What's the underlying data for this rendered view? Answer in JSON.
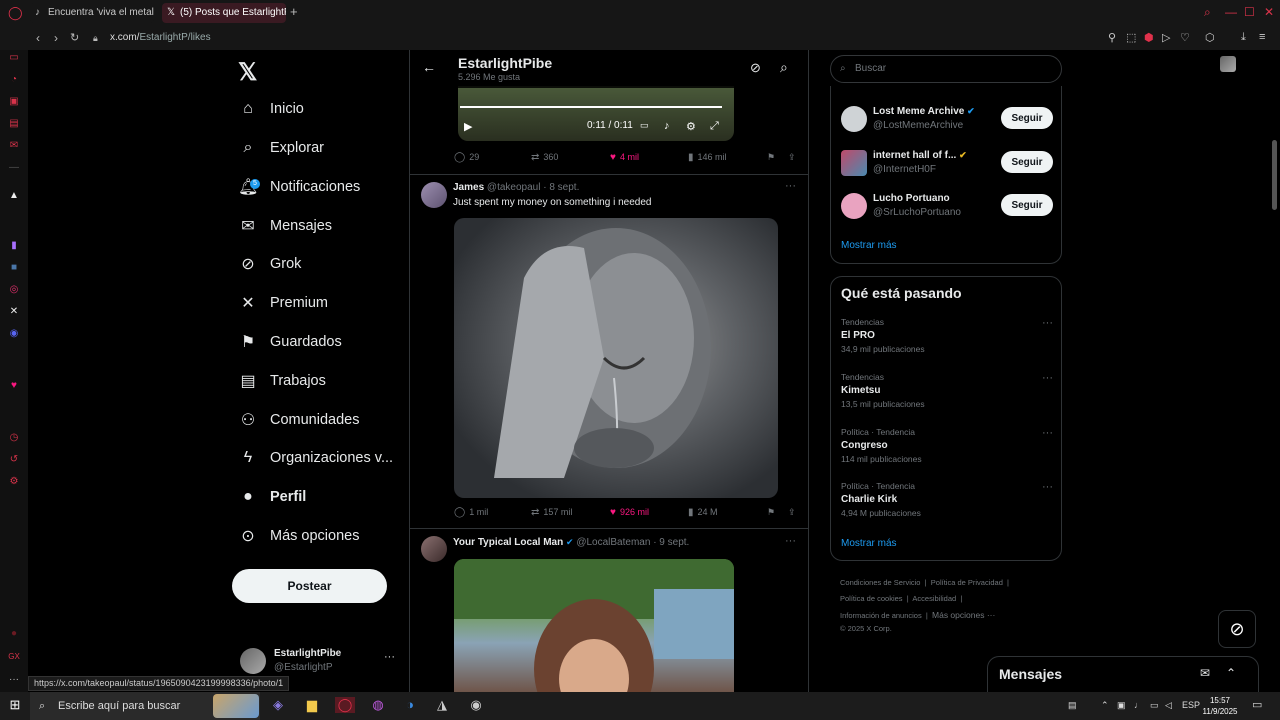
{
  "browser": {
    "tabs": [
      {
        "label": "Encuentra 'viva el metal e",
        "icon": "tiktok-icon"
      },
      {
        "label": "(5) Posts que EstarlightP",
        "icon": "x-icon"
      }
    ],
    "url_host": "x.com/",
    "url_path": "EstarlightP/likes",
    "status_url": "https://x.com/takeopaul/status/1965090423199998336/photo/1"
  },
  "nav": {
    "items": [
      {
        "label": "Inicio",
        "icon": "home-icon"
      },
      {
        "label": "Explorar",
        "icon": "search-icon"
      },
      {
        "label": "Notificaciones",
        "icon": "bell-icon",
        "badge": "5"
      },
      {
        "label": "Mensajes",
        "icon": "mail-icon"
      },
      {
        "label": "Grok",
        "icon": "grok-icon"
      },
      {
        "label": "Premium",
        "icon": "x-icon"
      },
      {
        "label": "Guardados",
        "icon": "bookmark-icon"
      },
      {
        "label": "Trabajos",
        "icon": "briefcase-icon"
      },
      {
        "label": "Comunidades",
        "icon": "people-icon"
      },
      {
        "label": "Organizaciones v...",
        "icon": "lightning-icon"
      },
      {
        "label": "Perfil",
        "icon": "person-icon"
      },
      {
        "label": "Más opciones",
        "icon": "more-circle-icon"
      }
    ],
    "post_label": "Postear",
    "profile_name": "EstarlightPibe",
    "profile_handle": "@EstarlightP"
  },
  "header": {
    "title": "EstarlightPibe",
    "subtitle": "5.296 Me gusta"
  },
  "video": {
    "time": "0:11 / 0:11"
  },
  "tweets": [
    {
      "replies": "29",
      "reposts": "360",
      "likes": "4 mil",
      "views": "146 mil"
    },
    {
      "name": "James",
      "handle": "@takeopaul",
      "date": "· 8 sept.",
      "text": "Just spent my money on something i needed",
      "replies": "1 mil",
      "reposts": "157 mil",
      "likes": "926 mil",
      "views": "24 M"
    },
    {
      "name": "Your Typical Local Man",
      "handle": "@LocalBateman",
      "date": "· 9 sept."
    }
  ],
  "right": {
    "search_placeholder": "Buscar",
    "who_to_follow": [
      {
        "name": "Lost Meme Archive",
        "handle": "@LostMemeArchive",
        "button": "Seguir"
      },
      {
        "name": "internet hall of f...",
        "handle": "@InternetH0F",
        "button": "Seguir"
      },
      {
        "name": "Lucho Portuano",
        "handle": "@SrLuchoPortuano",
        "button": "Seguir"
      }
    ],
    "show_more": "Mostrar más",
    "trends_title": "Qué está pasando",
    "trends": [
      {
        "context": "Tendencias",
        "name": "El PRO",
        "posts": "34,9 mil publicaciones"
      },
      {
        "context": "Tendencias",
        "name": "Kimetsu",
        "posts": "13,5 mil publicaciones"
      },
      {
        "context": "Política · Tendencia",
        "name": "Congreso",
        "posts": "114 mil publicaciones"
      },
      {
        "context": "Política · Tendencia",
        "name": "Charlie Kirk",
        "posts": "4,94 M publicaciones"
      }
    ],
    "footer": {
      "l1a": "Condiciones de Servicio",
      "l1b": "Política de Privacidad",
      "l2a": "Política de cookies",
      "l2b": "Accesibilidad",
      "l3a": "Información de anuncios",
      "l3b": "Más opciones ···",
      "copy": "© 2025 X Corp."
    },
    "messages_label": "Mensajes"
  },
  "taskbar": {
    "search_placeholder": "Escribe aquí para buscar",
    "lang": "ESP",
    "time": "15:57",
    "date": "11/9/2025"
  },
  "colors": {
    "accent": "#1d9bf0",
    "like": "#f91880",
    "background": "#000000"
  }
}
